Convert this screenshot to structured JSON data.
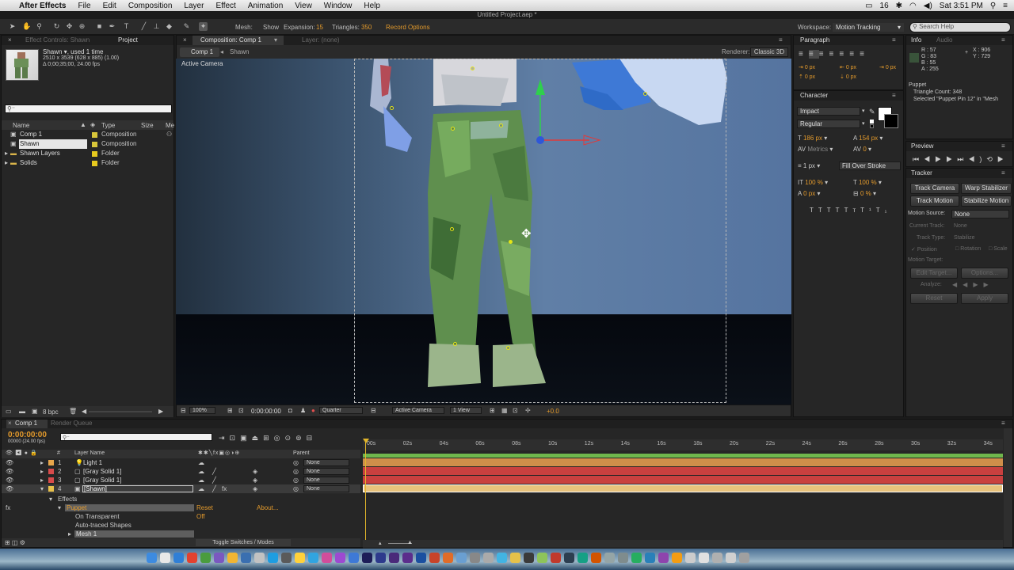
{
  "menubar": {
    "app": "After Effects",
    "items": [
      "File",
      "Edit",
      "Composition",
      "Layer",
      "Effect",
      "Animation",
      "View",
      "Window",
      "Help"
    ],
    "battery": "16",
    "clock": "Sat 3:51 PM"
  },
  "document_title": "Untitled Project.aep *",
  "toolbar": {
    "mesh_label": "Mesh:",
    "show_label": "Show",
    "expansion_label": "Expansion:",
    "expansion_value": "15",
    "triangles_label": "Triangles:",
    "triangles_value": "350",
    "record_options": "Record Options",
    "workspace_label": "Workspace:",
    "workspace_value": "Motion Tracking",
    "search_placeholder": "Search Help"
  },
  "project": {
    "tabs": [
      "Effect Controls: Shawn",
      "Project"
    ],
    "selected_name": "Shawn ▾, used 1 time",
    "dims": "2510 x 3539  (628 x 885) (1.00)",
    "duration": "Δ 0;00;35;00, 24.00 fps",
    "columns": [
      "Name",
      "Type",
      "Size",
      "Me"
    ],
    "items": [
      {
        "name": "Comp 1",
        "type": "Composition",
        "color": "#d8c63a"
      },
      {
        "name": "Shawn",
        "type": "Composition",
        "color": "#d8c63a"
      },
      {
        "name": "Shawn Layers",
        "type": "Folder",
        "color": "#e6c91e"
      },
      {
        "name": "Solids",
        "type": "Folder",
        "color": "#e6c91e"
      }
    ],
    "bpc": "8 bpc"
  },
  "comp": {
    "tab": "Composition: Comp 1",
    "layer_tab": "Layer: (none)",
    "crumbs": [
      "Comp 1",
      "Shawn"
    ],
    "renderer_label": "Renderer:",
    "renderer_value": "Classic 3D",
    "active_camera": "Active Camera",
    "footer": {
      "zoom": "100%",
      "timecode": "0:00:00:00",
      "resolution": "Quarter",
      "camera": "Active Camera",
      "views": "1 View",
      "exposure": "+0.0"
    }
  },
  "paragraph": {
    "title": "Paragraph",
    "indents": [
      "0 px",
      "0 px",
      "0 px",
      "0 px",
      "0 px"
    ]
  },
  "character": {
    "title": "Character",
    "font": "Impact",
    "style": "Regular",
    "size": "186 px",
    "leading": "154 px",
    "kerning": "Metrics",
    "tracking": "0",
    "stroke_width": "1 px",
    "stroke_mode": "Fill Over Stroke",
    "vscale": "100 %",
    "hscale": "100 %",
    "baseline": "0 px",
    "tsume": "0 %"
  },
  "info": {
    "tabs": [
      "Info",
      "Audio"
    ],
    "r": "R : 57",
    "g": "G : 83",
    "b": "B : 55",
    "a": "A : 255",
    "x": "X : 906",
    "y": "Y : 729",
    "line1": "Puppet",
    "line2": "Triangle Count: 348",
    "line3": "Selected \"Puppet Pin 12\" in \"Mesh"
  },
  "preview": {
    "title": "Preview"
  },
  "tracker": {
    "title": "Tracker",
    "track_camera": "Track Camera",
    "warp_stabilizer": "Warp Stabilizer",
    "track_motion": "Track Motion",
    "stabilize_motion": "Stabilize Motion",
    "motion_source_label": "Motion Source:",
    "motion_source": "None",
    "current_track_label": "Current Track:",
    "current_track": "None",
    "track_type_label": "Track Type:",
    "track_type": "Stabilize",
    "position": "Position",
    "rotation": "Rotation",
    "scale": "Scale",
    "motion_target": "Motion Target:",
    "edit_target": "Edit Target...",
    "options": "Options...",
    "analyze": "Analyze:",
    "reset": "Reset",
    "apply": "Apply"
  },
  "timeline": {
    "tabs": [
      "Comp 1",
      "Render Queue"
    ],
    "timecode": "0:00:00:00",
    "frame": "00000 (24.00 fps)",
    "col_layer": "Layer Name",
    "col_parent": "Parent",
    "layers": [
      {
        "num": "1",
        "name": "Light 1",
        "color": "#e8a64b",
        "parent": "None"
      },
      {
        "num": "2",
        "name": "[Gray Solid 1]",
        "color": "#d84b4b",
        "parent": "None"
      },
      {
        "num": "3",
        "name": "[Gray Solid 1]",
        "color": "#d84b4b",
        "parent": "None"
      },
      {
        "num": "4",
        "name": "[Shawn]",
        "color": "#e8c14b",
        "parent": "None"
      }
    ],
    "effects": "Effects",
    "puppet": "Puppet",
    "reset": "Reset",
    "about": "About...",
    "on_transparent": "On Transparent",
    "off": "Off",
    "auto_traced": "Auto-traced Shapes",
    "mesh1": "Mesh 1",
    "toggle": "Toggle Switches / Modes",
    "ruler": [
      "00s",
      "02s",
      "04s",
      "06s",
      "08s",
      "10s",
      "12s",
      "14s",
      "16s",
      "18s",
      "20s",
      "22s",
      "24s",
      "26s",
      "28s",
      "30s",
      "32s",
      "34s"
    ],
    "bars": [
      {
        "color": "#e09a3c"
      },
      {
        "color": "#c9403f"
      },
      {
        "color": "#c9403f"
      },
      {
        "color": "#e8c27c"
      }
    ]
  },
  "colors": {
    "accent": "#e39a2c",
    "work_area": "#6fb64c"
  }
}
